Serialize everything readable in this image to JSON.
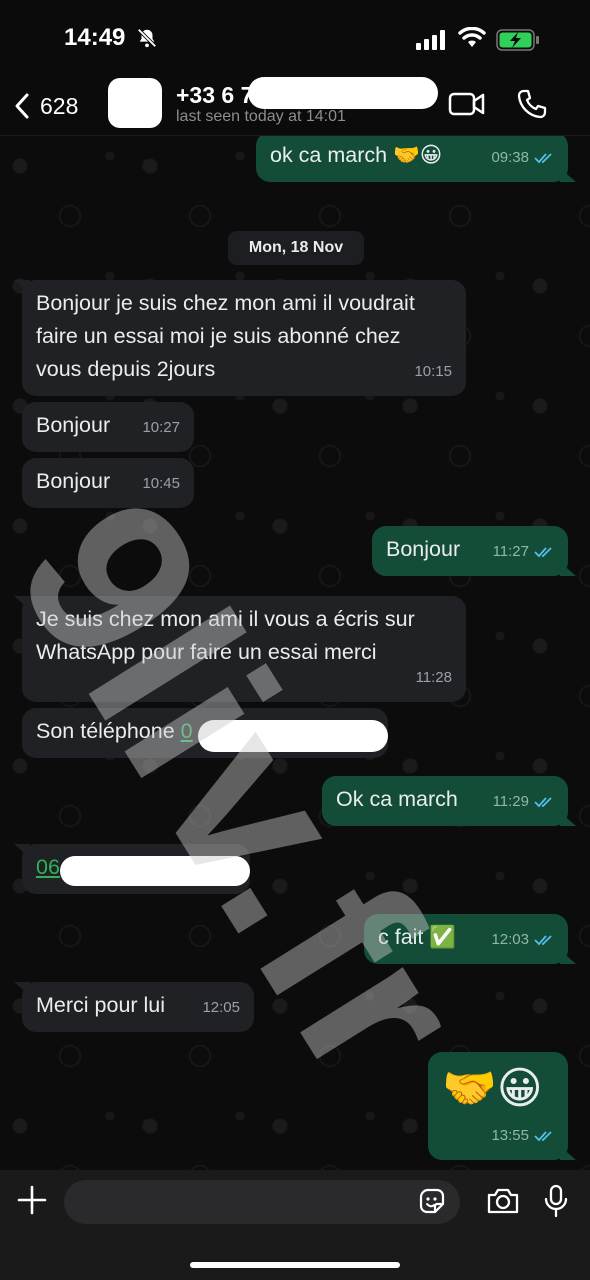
{
  "status_bar": {
    "time": "14:49"
  },
  "header": {
    "back_count": "628",
    "contact_name": "+33 6 7",
    "last_seen": "last seen today at 14:01"
  },
  "date_divider": "Mon, 18 Nov",
  "messages": [
    {
      "dir": "out",
      "text": "ok ca march 🤝😀",
      "time": "09:38",
      "read": true
    },
    {
      "dir": "in",
      "lines": [
        "Bonjour je suis chez mon ami il voudrait",
        "faire un essai  moi je suis abonné chez",
        "vous depuis 2jours"
      ],
      "time": "10:15"
    },
    {
      "dir": "in",
      "text": "Bonjour",
      "time": "10:27"
    },
    {
      "dir": "in",
      "text": "Bonjour",
      "time": "10:45"
    },
    {
      "dir": "out",
      "text": "Bonjour",
      "time": "11:27",
      "read": true
    },
    {
      "dir": "in",
      "lines": [
        "Je suis chez mon ami il vous a écris sur",
        "WhatsApp pour faire un essai  merci"
      ],
      "time": "11:28"
    },
    {
      "dir": "in",
      "text": "Son téléphone",
      "link": "0"
    },
    {
      "dir": "out",
      "text": "Ok ca march",
      "time": "11:29",
      "read": true
    },
    {
      "dir": "in",
      "link": "06"
    },
    {
      "dir": "out",
      "text": "c fait ✅",
      "time": "12:03",
      "read": true
    },
    {
      "dir": "in",
      "text": "Merci pour lui",
      "time": "12:05"
    },
    {
      "dir": "out",
      "text": "🤝😀",
      "time": "13:55",
      "read": true
    }
  ],
  "watermark": "9liv.fr",
  "colors": {
    "out_bubble": "#134d37",
    "in_bubble": "#1f2124",
    "tick_blue": "#53bdeb",
    "link_green": "#2fb15a"
  },
  "icons": [
    "back-chevron-icon",
    "video-call-icon",
    "phone-icon",
    "plus-icon",
    "sticker-icon",
    "camera-icon",
    "mic-icon",
    "bell-slash-icon",
    "signal-icon",
    "wifi-icon",
    "battery-charging-icon"
  ]
}
